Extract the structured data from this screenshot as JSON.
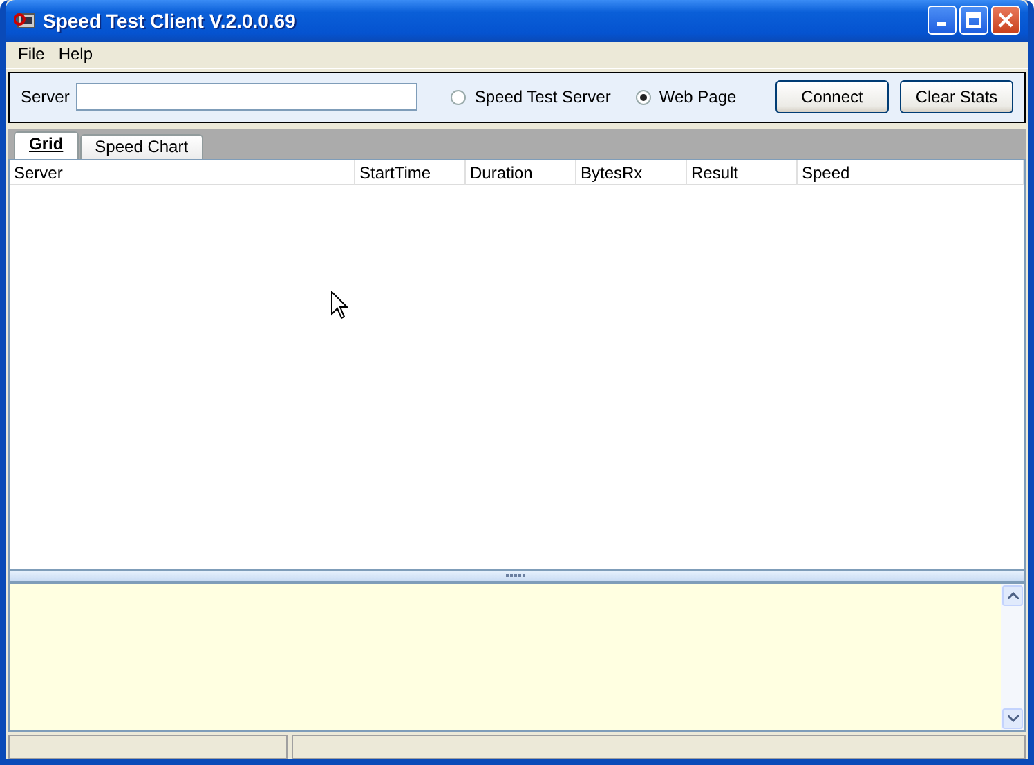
{
  "window": {
    "title": "Speed Test Client V.2.0.0.69"
  },
  "menu": [
    "File",
    "Help"
  ],
  "toolbar": {
    "server_label": "Server",
    "mode_options": [
      {
        "label": "Speed Test Server",
        "selected": false
      },
      {
        "label": "Web Page",
        "selected": true
      }
    ],
    "buttons": [
      "Connect",
      "Clear Stats"
    ]
  },
  "tabs": [
    {
      "label": "Grid",
      "selected": true
    },
    {
      "label": "Speed Chart",
      "selected": false
    }
  ],
  "grid": {
    "columns": [
      "Server",
      "StartTime",
      "Duration",
      "BytesRx",
      "Result",
      "Speed"
    ]
  }
}
